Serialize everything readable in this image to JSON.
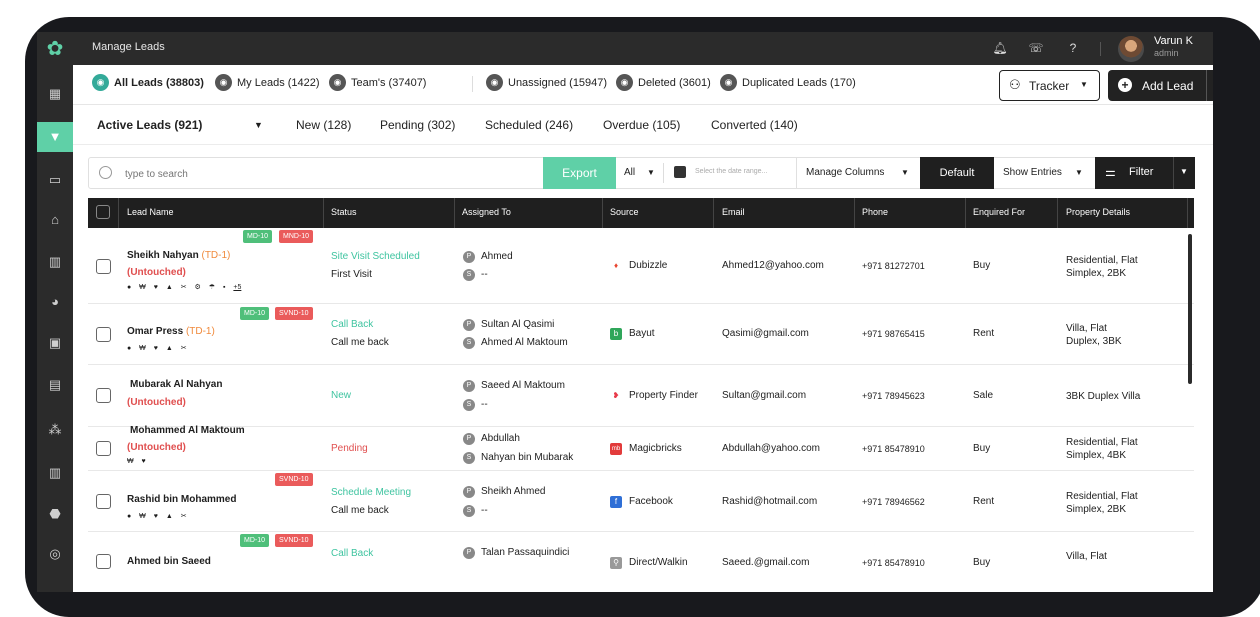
{
  "topbar": {
    "title": "Manage Leads",
    "user_name": "Varun K",
    "user_role": "admin",
    "icons": [
      "bell-icon",
      "phone-icon",
      "help-icon"
    ]
  },
  "sidebar": {
    "items": [
      "dashboard-icon",
      "leads-icon",
      "contacts-icon",
      "properties-icon",
      "buildings-icon",
      "reports-icon",
      "calendar-icon",
      "tasks-icon",
      "team-icon",
      "projects-icon",
      "settings-icon",
      "support-icon"
    ]
  },
  "lead_tabs": {
    "all": "All Leads (38803)",
    "mine": "My Leads (1422)",
    "team": "Team's (37407)",
    "unassigned": "Unassigned (15947)",
    "deleted": "Deleted (3601)",
    "duplicated": "Duplicated Leads (170)",
    "tracker": "Tracker",
    "add_lead": "Add Lead"
  },
  "status_tabs": {
    "active": "Active Leads (921)",
    "new": "New (128)",
    "pending": "Pending (302)",
    "scheduled": "Scheduled (246)",
    "overdue": "Overdue (105)",
    "converted": "Converted (140)"
  },
  "toolbar": {
    "search_placeholder": "type to search",
    "export": "Export",
    "all": "All",
    "date_placeholder": "Select the date range...",
    "manage_columns": "Manage Columns",
    "default": "Default",
    "show_entries": "Show Entries",
    "filter": "Filter"
  },
  "table": {
    "headers": [
      "Lead Name",
      "Status",
      "Assigned To",
      "Source",
      "Email",
      "Phone",
      "Enquired For",
      "Property Details"
    ],
    "rows": [
      {
        "name": "Sheikh Nahyan",
        "tag": "(TD-1)",
        "untouched": "(Untouched)",
        "icons": "● ₩ ♥ ▲ ✂ ⚙ ☂ ▪",
        "more": "+5",
        "badges": [
          "MD-10",
          "MND-10"
        ],
        "status": "Site Visit Scheduled",
        "substatus": "First Visit",
        "assigned": [
          "Ahmed",
          "--"
        ],
        "source": "Dubizzle",
        "email": "Ahmed12@yahoo.com",
        "phone": "+971 81272701",
        "enquired": "Buy",
        "property": [
          "Residential, Flat",
          "Simplex, 2BK"
        ]
      },
      {
        "name": "Omar Press",
        "tag": "(TD-1)",
        "untouched": "",
        "icons": "● ₩ ♥ ▲ ✂",
        "more": "",
        "badges": [
          "MD-10",
          "SVND-10"
        ],
        "status": "Call Back",
        "substatus": "Call me back",
        "assigned": [
          "Sultan Al Qasimi",
          "Ahmed Al Maktoum"
        ],
        "source": "Bayut",
        "email": "Qasimi@gmail.com",
        "phone": "+971 98765415",
        "enquired": "Rent",
        "property": [
          "Villa, Flat",
          "Duplex, 3BK"
        ]
      },
      {
        "name": "Mubarak Al Nahyan",
        "tag": "",
        "untouched": "(Untouched)",
        "icons": "",
        "more": "",
        "badges": [],
        "status": "New",
        "substatus": "",
        "assigned": [
          "Saeed Al Maktoum",
          "--"
        ],
        "source": "Property Finder",
        "email": "Sultan@gmail.com",
        "phone": "+971 78945623",
        "enquired": "Sale",
        "property": [
          "3BK Duplex Villa",
          ""
        ]
      },
      {
        "name": "Mohammed Al Maktoum",
        "tag": "",
        "untouched": "(Untouched)",
        "icons": "₩ ♥",
        "more": "",
        "badges": [],
        "status": "Pending",
        "substatus": "",
        "assigned": [
          "Abdullah",
          "Nahyan bin Mubarak"
        ],
        "source": "Magicbricks",
        "email": "Abdullah@yahoo.com",
        "phone": "+971 85478910",
        "enquired": "Buy",
        "property": [
          "Residential, Flat",
          "Simplex, 4BK"
        ]
      },
      {
        "name": "Rashid bin Mohammed",
        "tag": "",
        "untouched": "",
        "icons": "● ₩ ♥ ▲ ✂",
        "more": "",
        "badges": [
          "SVND-10"
        ],
        "status": "Schedule Meeting",
        "substatus": "Call me back",
        "assigned": [
          "Sheikh Ahmed",
          "--"
        ],
        "source": "Facebook",
        "email": "Rashid@hotmail.com",
        "phone": "+971 78946562",
        "enquired": "Rent",
        "property": [
          "Residential, Flat",
          "Simplex, 2BK"
        ]
      },
      {
        "name": "Ahmed bin Saeed",
        "tag": "",
        "untouched": "",
        "icons": "",
        "more": "",
        "badges": [
          "MD-10",
          "SVND-10"
        ],
        "status": "Call Back",
        "substatus": "",
        "assigned": [
          "Talan Passaquindici",
          ""
        ],
        "source": "Direct/Walkin",
        "email": "Saeed.@gmail.com",
        "phone": "+971 85478910",
        "enquired": "Buy",
        "property": [
          "Villa, Flat",
          ""
        ]
      }
    ]
  },
  "colors": {
    "accent": "#5fd0a7",
    "danger": "#e04f4f",
    "dark": "#1f1f1f"
  }
}
